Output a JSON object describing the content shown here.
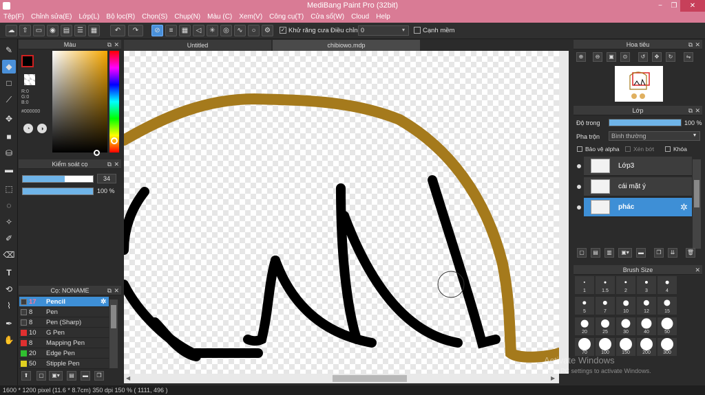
{
  "window": {
    "title": "MediBang Paint Pro (32bit)",
    "min_glyph": "−",
    "max_glyph": "❐",
    "close_glyph": "✕"
  },
  "menu": [
    "Tệp(F)",
    "Chỉnh sửa(E)",
    "Lớp(L)",
    "Bộ lọc(R)",
    "Chọn(S)",
    "Chụp(N)",
    "Màu (C)",
    "Xem(V)",
    "Công cụ(T)",
    "Cửa sổ(W)",
    "Cloud",
    "Help"
  ],
  "toolbar": {
    "antialias_label": "Khử răng cưa",
    "adjust_label": "Điều chỉnh",
    "adjust_value": "0",
    "smooth_label": "Cạnh mềm"
  },
  "tabs": [
    {
      "label": "Untitled"
    },
    {
      "label": "chibiowo.mdp"
    }
  ],
  "color_panel": {
    "title": "Màu",
    "r": "R:0",
    "g": "G:0",
    "b": "B:0",
    "hex": "#000000",
    "primary_color": "#000000"
  },
  "brush_control": {
    "title": "Kiểm soát cọ",
    "size_value": "34",
    "size_fraction": 0.6,
    "opacity_value": "100 %",
    "opacity_fraction": 1.0
  },
  "brush_list": {
    "title": "Cọ: NONAME",
    "items": [
      {
        "size": "17",
        "name": "Pencil",
        "color": "#3d3d3d",
        "active": true
      },
      {
        "size": "8",
        "name": "Pen",
        "color": "#3d3d3d"
      },
      {
        "size": "8",
        "name": "Pen (Sharp)",
        "color": "#3d3d3d"
      },
      {
        "size": "10",
        "name": "G Pen",
        "color": "#e03030"
      },
      {
        "size": "8",
        "name": "Mapping Pen",
        "color": "#e03030"
      },
      {
        "size": "20",
        "name": "Edge Pen",
        "color": "#30c030"
      },
      {
        "size": "50",
        "name": "Stipple Pen",
        "color": "#e0d020"
      }
    ]
  },
  "navigator": {
    "title": "Hoa tiêu"
  },
  "layer_panel": {
    "title": "Lớp",
    "opacity_label": "Độ trong",
    "opacity_value": "100 %",
    "opacity_fraction": 1.0,
    "blend_label": "Pha trộn",
    "blend_value": "Bình thường",
    "protect_alpha": "Bảo vệ alpha",
    "clipping": "Xén bớt",
    "lock": "Khóa",
    "layers": [
      {
        "name": "Lớp3"
      },
      {
        "name": "cái mặt ý"
      },
      {
        "name": "phác",
        "active": true
      }
    ]
  },
  "brush_size": {
    "title": "Brush Size",
    "sizes": [
      "1",
      "1.5",
      "2",
      "3",
      "4",
      "5",
      "7",
      "10",
      "12",
      "15",
      "20",
      "25",
      "30",
      "40",
      "50",
      "70",
      "100",
      "150",
      "200",
      "300"
    ]
  },
  "watermark": {
    "line1": "Activate Windows",
    "line2": "Go to PC settings to activate Windows."
  },
  "status": "1600 * 1200 pixel   (11.6 * 8.7cm)  350 dpi  150 %   ( 1111, 496 )",
  "colors": {
    "accent": "#4a90d9",
    "titlebar": "#d97b95",
    "stroke_brown": "#a57a1c",
    "stroke_black": "#000000"
  }
}
